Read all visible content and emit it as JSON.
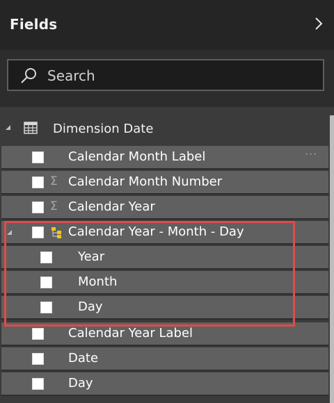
{
  "header": {
    "title": "Fields"
  },
  "search": {
    "placeholder": "Search"
  },
  "table": {
    "name": "Dimension Date"
  },
  "fields": [
    {
      "label": "Calendar Month Label",
      "icon": "none"
    },
    {
      "label": "Calendar Month Number",
      "icon": "sigma-icon"
    },
    {
      "label": "Calendar Year",
      "icon": "sigma-icon"
    },
    {
      "label": "Calendar Year - Month - Day",
      "icon": "hierarchy-icon"
    },
    {
      "label": "Year",
      "icon": "none"
    },
    {
      "label": "Month",
      "icon": "none"
    },
    {
      "label": "Day",
      "icon": "none"
    },
    {
      "label": "Calendar Year Label",
      "icon": "none"
    },
    {
      "label": "Date",
      "icon": "none"
    },
    {
      "label": "Day",
      "icon": "none"
    }
  ],
  "more_label": "···",
  "colors": {
    "highlight": "#e04a4a",
    "row": "#606060",
    "header": "#252525"
  }
}
